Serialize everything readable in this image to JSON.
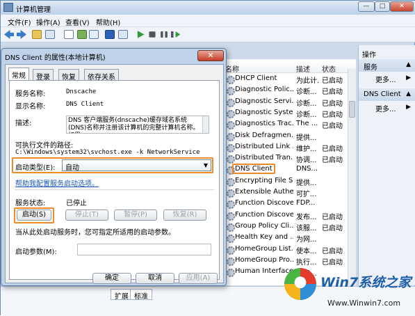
{
  "window": {
    "title": "计算机管理",
    "minimize": "—",
    "maximize": "□",
    "close": "✕"
  },
  "menu": [
    "文件(F)",
    "操作(A)",
    "查看(V)",
    "帮助(H)"
  ],
  "toolbar_icons": [
    "back-arrow-icon",
    "forward-arrow-icon",
    "up-folder-icon",
    "console-tree-icon",
    "properties-icon",
    "refresh-icon",
    "export-list-icon",
    "help-icon",
    "show-hide-icon",
    "play-icon",
    "stop-icon",
    "pause-icon",
    "restart-icon"
  ],
  "services": {
    "columns": {
      "name": "名称",
      "desc": "描述",
      "status": "状态"
    },
    "rows": [
      {
        "name": "DHCP Client",
        "desc": "为此计...",
        "status": "已启动"
      },
      {
        "name": "Diagnostic Polic...",
        "desc": "诊断...",
        "status": "已启动"
      },
      {
        "name": "Diagnostic Servi...",
        "desc": "诊断...",
        "status": "已启动"
      },
      {
        "name": "Diagnostic Syste...",
        "desc": "诊断...",
        "status": "已启动"
      },
      {
        "name": "Diagnostics Trac...",
        "desc": "The ...",
        "status": "已启动"
      },
      {
        "name": "Disk Defragmen...",
        "desc": "提供...",
        "status": ""
      },
      {
        "name": "Distributed Link ...",
        "desc": "维护...",
        "status": "已启动"
      },
      {
        "name": "Distributed Tran...",
        "desc": "协调...",
        "status": "已启动"
      },
      {
        "name": "DNS Client",
        "desc": "DNS...",
        "status": ""
      },
      {
        "name": "Encrypting File S...",
        "desc": "提供...",
        "status": ""
      },
      {
        "name": "Extensible Authe...",
        "desc": "可扩...",
        "status": ""
      },
      {
        "name": "Function Discove...",
        "desc": "FDP...",
        "status": ""
      },
      {
        "name": "Function Discove...",
        "desc": "发布...",
        "status": "已启动"
      },
      {
        "name": "Group Policy Cli...",
        "desc": "该服...",
        "status": "已启动"
      },
      {
        "name": "Health Key and ...",
        "desc": "为网...",
        "status": ""
      },
      {
        "name": "HomeGroup List...",
        "desc": "使本...",
        "status": "已启动"
      },
      {
        "name": "HomeGroup Pro...",
        "desc": "执行...",
        "status": "已启动"
      },
      {
        "name": "Human Interface...",
        "desc": "启用...",
        "status": ""
      }
    ]
  },
  "actions": {
    "header": "操作",
    "section1": "服务",
    "more1": "更多...",
    "section2": "DNS Client",
    "more2": "更多..."
  },
  "bottom_tabs": [
    "扩展",
    "标准"
  ],
  "dialog": {
    "title": "DNS Client 的属性(本地计算机)",
    "close": "✕",
    "tabs": [
      "常规",
      "登录",
      "恢复",
      "依存关系"
    ],
    "service_name_label": "服务名称:",
    "service_name": "Dnscache",
    "display_name_label": "显示名称:",
    "display_name": "DNS Client",
    "description_label": "描述:",
    "description": "DNS 客户端服务(dnscache)缓存域名系统(DNS)名称并注册该计算机的完整计算机名称。如果",
    "exe_path_label": "可执行文件的路径:",
    "exe_path": "C:\\Windows\\system32\\svchost.exe -k NetworkService",
    "startup_type_label": "启动类型(E):",
    "startup_type": "自动",
    "help_link": "帮助我配置服务启动选项。",
    "status_label": "服务状态:",
    "status": "已停止",
    "btn_start": "启动(S)",
    "btn_stop": "停止(T)",
    "btn_pause": "暂停(P)",
    "btn_resume": "恢复(R)",
    "start_hint": "当从此处启动服务时，您可指定所适用的启动参数。",
    "start_param_label": "启动参数(M):",
    "start_param": "",
    "ok": "确定",
    "cancel": "取消",
    "apply": "应用(A)"
  },
  "watermark": {
    "brand": "Win7系统之家",
    "url": "Www.Winwin7.com"
  },
  "colors": {
    "highlight_orange": "#f08a24",
    "link_blue": "#1a55b8",
    "title_gradient_top": "#dfe9f5"
  }
}
